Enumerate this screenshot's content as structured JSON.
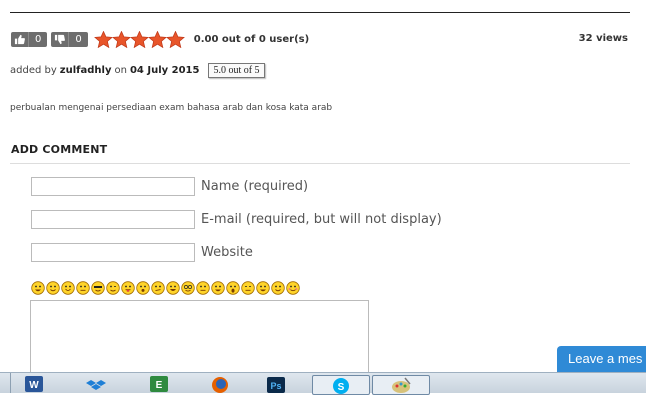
{
  "votes": {
    "like_count": "0",
    "dislike_count": "0"
  },
  "rating": {
    "stars_total": 5,
    "stars_filled": 5,
    "text": "0.00 out of 0 user(s)",
    "star_color": "#e8552a"
  },
  "views": "32 views",
  "added": {
    "prefix": "added by",
    "user": "zulfadhly",
    "on": "on",
    "date": "04 July 2015",
    "tooltip": "5.0 out of 5"
  },
  "description": "perbualan mengenai persediaan exam bahasa arab dan kosa kata arab",
  "comment_form": {
    "heading": "ADD COMMENT",
    "name_label": "Name (required)",
    "email_label": "E-mail (required, but will not display)",
    "website_label": "Website",
    "name_value": "",
    "email_value": "",
    "website_value": "",
    "comment_value": "",
    "smileys": [
      "grin",
      "smile",
      "happy",
      "neutral",
      "cool",
      "wink",
      "tongue",
      "surprised",
      "confused",
      "laugh",
      "glasses",
      "roll",
      "grin",
      "shock",
      "sleep",
      "grin",
      "smile",
      "blush"
    ]
  },
  "chat": {
    "label": "Leave a mes",
    "color": "#2f8ad6"
  },
  "taskbar": {
    "apps": [
      "word-icon",
      "dropbox-icon",
      "excel-icon",
      "firefox-icon",
      "photoshop-icon",
      "skype-icon",
      "paint-icon"
    ]
  }
}
